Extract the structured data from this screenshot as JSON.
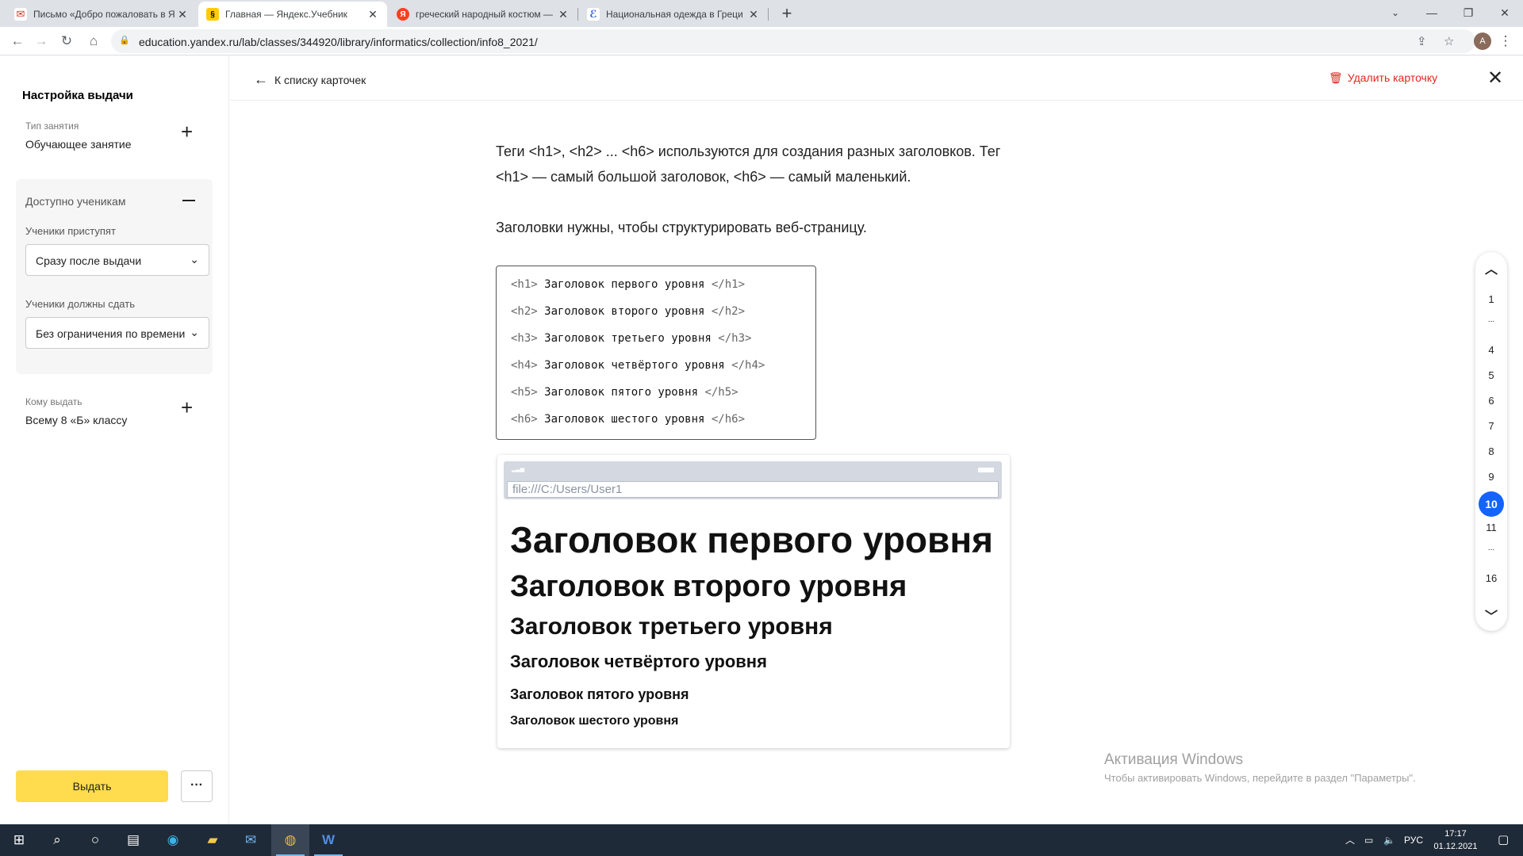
{
  "browser": {
    "tabs": [
      {
        "title": "Письмо «Добро пожаловать в Я",
        "favicon": "gmail-icon",
        "active": false
      },
      {
        "title": "Главная — Яндекс.Учебник",
        "favicon": "yandex-uchebnik-icon",
        "active": true
      },
      {
        "title": "греческий народный костюм —",
        "favicon": "yandex-icon",
        "active": false
      },
      {
        "title": "Национальная одежда в Греци",
        "favicon": "site-icon",
        "active": false
      }
    ],
    "url": "education.yandex.ru/lab/classes/344920/library/informatics/collection/info8_2021/",
    "avatar_letter": "A"
  },
  "sidebar": {
    "title": "Настройка выдачи",
    "lesson_type_label": "Тип занятия",
    "lesson_type_value": "Обучающее занятие",
    "available_header": "Доступно ученикам",
    "start_label": "Ученики приступят",
    "start_value": "Сразу после выдачи",
    "due_label": "Ученики должны сдать",
    "due_value": "Без ограничения по времени",
    "assign_to_label": "Кому выдать",
    "assign_to_value": "Всему 8 «Б» классу",
    "issue_button": "Выдать",
    "more_button": "···"
  },
  "header": {
    "back_label": "К списку карточек",
    "delete_label": "Удалить карточку"
  },
  "content": {
    "para1_line1": "Теги <h1>, <h2> ... <h6> используются для создания разных заголовков. Тег",
    "para1_line2": "<h1> — самый большой заголовок, <h6> — самый маленький.",
    "para2": "Заголовки нужны, чтобы структурировать веб-страницу.",
    "code": [
      {
        "open": "<h1>",
        "text": " Заголовок первого уровня ",
        "close": "</h1>"
      },
      {
        "open": "<h2>",
        "text": " Заголовок второго уровня ",
        "close": "</h2>"
      },
      {
        "open": "<h3>",
        "text": " Заголовок третьего уровня ",
        "close": "</h3>"
      },
      {
        "open": "<h4>",
        "text": " Заголовок четвёртого уровня ",
        "close": "</h4>"
      },
      {
        "open": "<h5>",
        "text": " Заголовок пятого уровня ",
        "close": "</h5>"
      },
      {
        "open": "<h6>",
        "text": " Заголовок шестого уровня ",
        "close": "</h6>"
      }
    ],
    "preview_url": "file:///C:/Users/User1",
    "preview_headings": [
      "Заголовок первого уровня",
      "Заголовок второго уровня",
      "Заголовок третьего уровня",
      "Заголовок четвёртого уровня",
      "Заголовок пятого уровня",
      "Заголовок шестого уровня"
    ]
  },
  "pagination": {
    "items": [
      "1",
      "...",
      "4",
      "5",
      "6",
      "7",
      "8",
      "9",
      "10",
      "11",
      "...",
      "16"
    ],
    "current": "10"
  },
  "watermark": {
    "line1": "Активация Windows",
    "line2": "Чтобы активировать Windows, перейдите в раздел \"Параметры\"."
  },
  "taskbar": {
    "language": "РУС",
    "time": "17:17",
    "date": "01.12.2021"
  },
  "colors": {
    "accent_blue": "#1463ff",
    "issue_yellow": "#ffdb4d",
    "delete_red": "#e2261e"
  }
}
